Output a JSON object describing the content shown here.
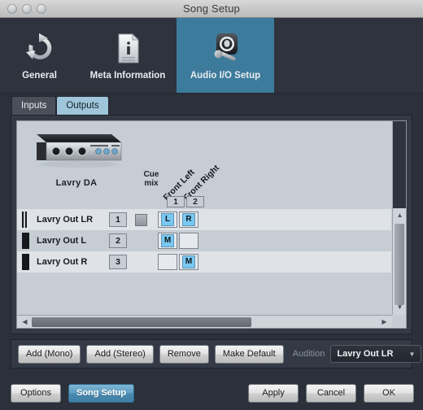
{
  "window": {
    "title": "Song Setup",
    "traffic_lights": [
      "close",
      "minimize",
      "zoom"
    ]
  },
  "toolbar": {
    "items": [
      {
        "label": "General",
        "icon": "refresh-icon",
        "selected": false
      },
      {
        "label": "Meta Information",
        "icon": "document-info-icon",
        "selected": false
      },
      {
        "label": "Audio I/O Setup",
        "icon": "speaker-microphone-icon",
        "selected": true
      }
    ],
    "accent_color": "#3d7b9c"
  },
  "tabs": [
    {
      "label": "Inputs",
      "active": false
    },
    {
      "label": "Outputs",
      "active": true
    }
  ],
  "device": {
    "name": "Lavry  DA",
    "icon": "audio-interface-icon"
  },
  "table": {
    "cue_label_line1": "Cue",
    "cue_label_line2": "mix",
    "channel_headers": [
      {
        "name": "Front Left",
        "number": "1"
      },
      {
        "name": "Front Right",
        "number": "2"
      }
    ],
    "rows": [
      {
        "name": "Lavry Out LR",
        "number": "1",
        "kind": "stereo",
        "cue_mix": true,
        "cells": [
          "L",
          "R"
        ],
        "selected": true
      },
      {
        "name": "Lavry Out L",
        "number": "2",
        "kind": "mono",
        "cue_mix": false,
        "cells": [
          "M",
          ""
        ],
        "selected": false
      },
      {
        "name": "Lavry Out R",
        "number": "3",
        "kind": "mono",
        "cue_mix": false,
        "cells": [
          "",
          "M"
        ],
        "selected": false
      }
    ]
  },
  "scrollbars": {
    "vertical_up": "▲",
    "vertical_down": "▼",
    "horizontal_left": "◀",
    "horizontal_right": "▶"
  },
  "actions": {
    "add_mono": "Add (Mono)",
    "add_stereo": "Add (Stereo)",
    "remove": "Remove",
    "make_default": "Make Default",
    "audition_label": "Audition",
    "audition_value": "Lavry Out LR",
    "audition_arrow": "▼"
  },
  "footer": {
    "options": "Options",
    "song_setup": "Song Setup",
    "apply": "Apply",
    "cancel": "Cancel",
    "ok": "OK"
  },
  "colors": {
    "window_bg": "#2b303a",
    "panel_bg": "#c6cdd4",
    "accent": "#3d7b9c",
    "badge": "#79c8f2"
  }
}
